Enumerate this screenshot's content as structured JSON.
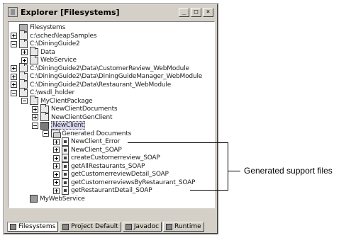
{
  "window": {
    "title": "Explorer [Filesystems]",
    "buttons": {
      "minimize": "_",
      "maximize": "□",
      "close": "×"
    }
  },
  "tree": {
    "nodes": [
      {
        "label": "Filesystems",
        "icon": "filesystems-icon",
        "toggle": "none",
        "depth": 0
      },
      {
        "label": "c:\\sched\\leapSamples",
        "icon": "folder-icon",
        "toggle": "plus",
        "depth": 0
      },
      {
        "label": "C:\\DiningGuide2",
        "icon": "folder-icon",
        "toggle": "minus",
        "depth": 0
      },
      {
        "label": "Data",
        "icon": "folder-icon",
        "toggle": "plus",
        "depth": 1
      },
      {
        "label": "WebService",
        "icon": "folder-icon",
        "toggle": "plus",
        "depth": 1
      },
      {
        "label": "C:\\DiningGuide2\\Data\\CustomerReview_WebModule",
        "icon": "folder-icon",
        "toggle": "plus",
        "depth": 0
      },
      {
        "label": "C:\\DiningGuide2\\Data\\DiningGuideManager_WebModule",
        "icon": "folder-icon",
        "toggle": "plus",
        "depth": 0
      },
      {
        "label": "C:\\DiningGuide2\\Data\\Restaurant_WebModule",
        "icon": "folder-icon",
        "toggle": "plus",
        "depth": 0
      },
      {
        "label": "C:\\wsdl_holder",
        "icon": "folder-icon",
        "toggle": "minus",
        "depth": 0
      },
      {
        "label": "MyClientPackage",
        "icon": "folder-icon",
        "toggle": "minus",
        "depth": 1
      },
      {
        "label": "NewClientDocuments",
        "icon": "folder-icon",
        "toggle": "plus",
        "depth": 2
      },
      {
        "label": "NewClientGenClient",
        "icon": "folder-icon",
        "toggle": "plus",
        "depth": 2
      },
      {
        "label": "NewClient",
        "icon": "client-icon",
        "toggle": "minus",
        "depth": 2,
        "selected": true
      },
      {
        "label": "Generated Documents",
        "icon": "folder-open-icon",
        "toggle": "minus",
        "depth": 3
      },
      {
        "label": "NewClient_Error",
        "icon": "file-icon",
        "toggle": "plus",
        "depth": 4
      },
      {
        "label": "NewClient_SOAP",
        "icon": "file-icon",
        "toggle": "plus",
        "depth": 4
      },
      {
        "label": "createCustomerreview_SOAP",
        "icon": "file-icon",
        "toggle": "plus",
        "depth": 4
      },
      {
        "label": "getAllRestaurants_SOAP",
        "icon": "file-icon",
        "toggle": "plus",
        "depth": 4
      },
      {
        "label": "getCustomerreviewDetail_SOAP",
        "icon": "file-icon",
        "toggle": "plus",
        "depth": 4
      },
      {
        "label": "getCustomerreviewsByRestaurant_SOAP",
        "icon": "file-icon",
        "toggle": "plus",
        "depth": 4
      },
      {
        "label": "getRestaurantDetail_SOAP",
        "icon": "file-icon",
        "toggle": "plus",
        "depth": 4
      },
      {
        "label": "MyWebService",
        "icon": "webservice-icon",
        "toggle": "none",
        "depth": 1
      }
    ]
  },
  "tabs": [
    {
      "label": "Filesystems",
      "active": true
    },
    {
      "label": "Project Default",
      "active": false
    },
    {
      "label": "Javadoc",
      "active": false
    },
    {
      "label": "Runtime",
      "active": false
    }
  ],
  "callout": {
    "label": "Generated support files"
  }
}
